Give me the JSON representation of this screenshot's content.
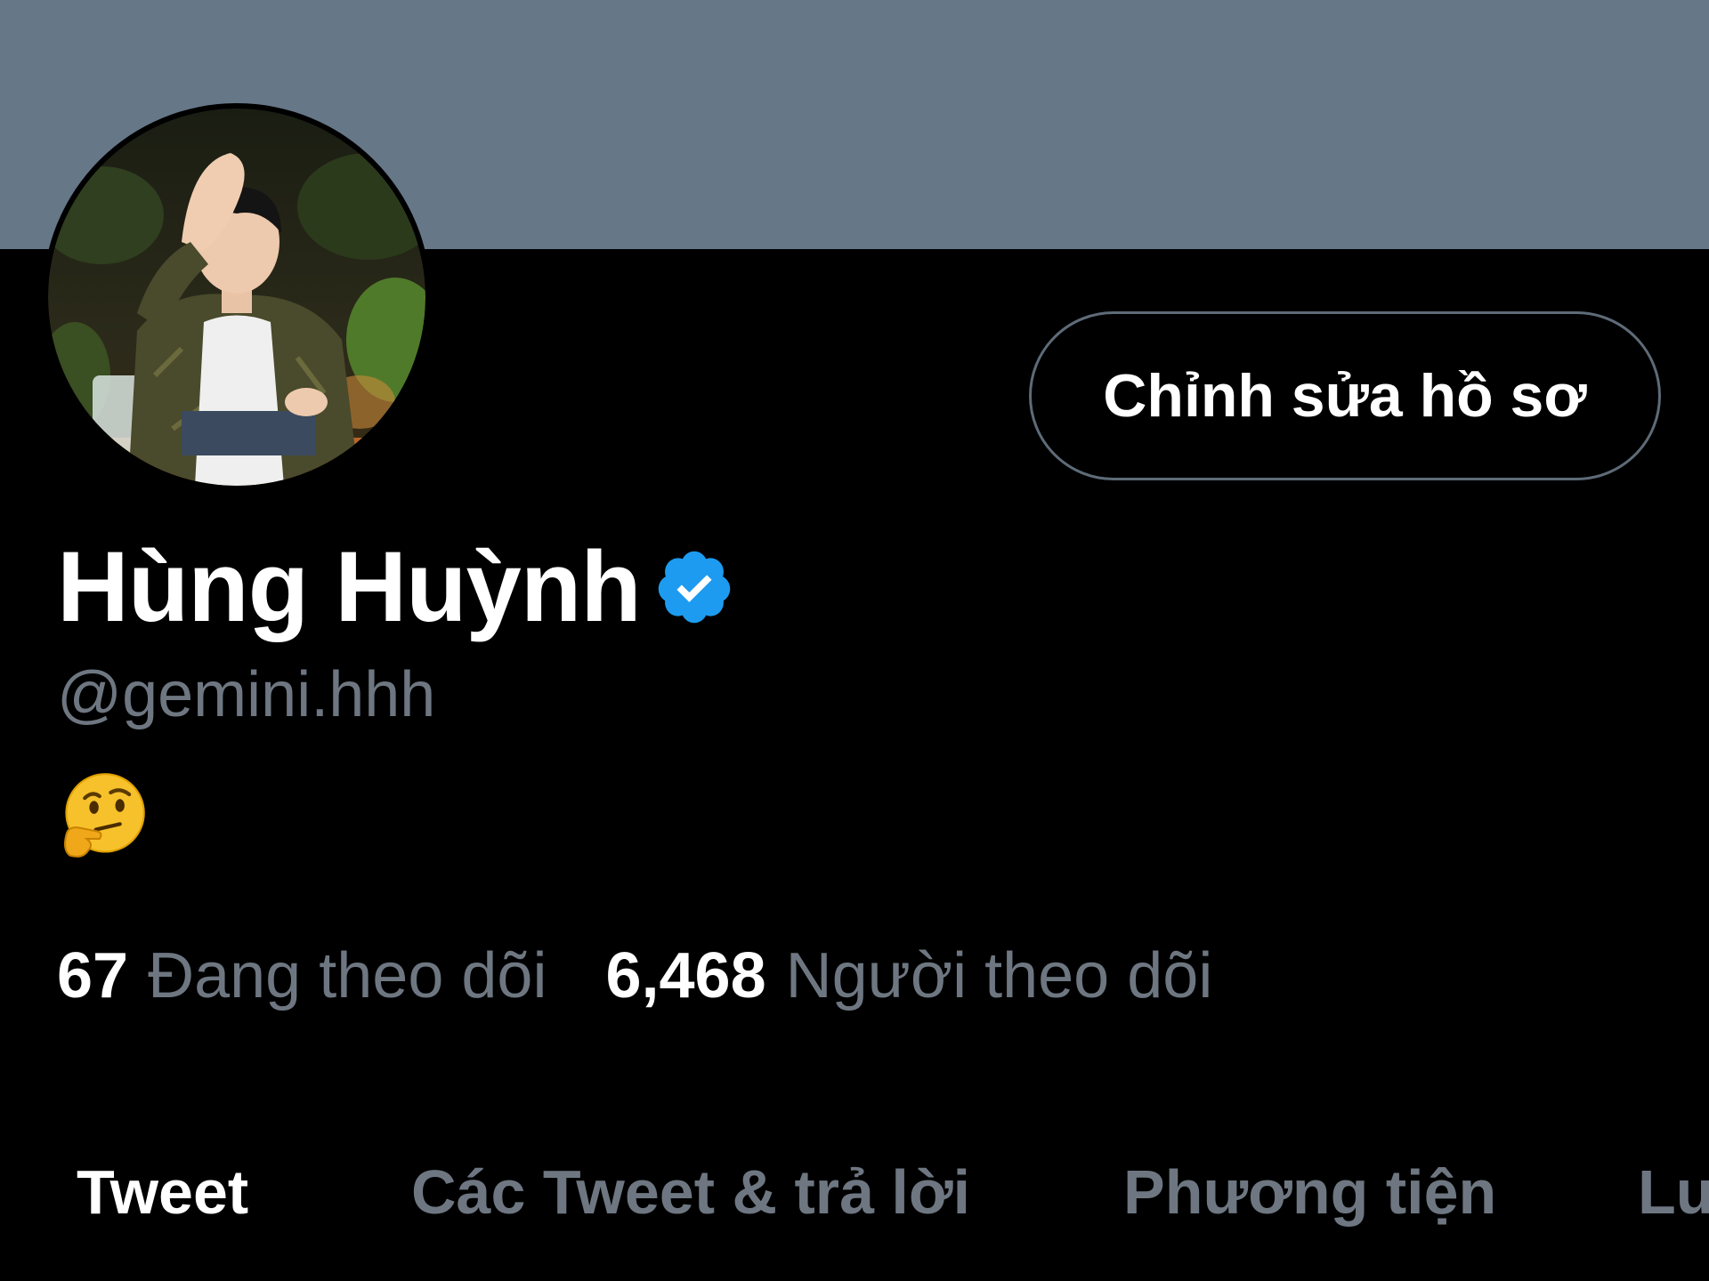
{
  "profile": {
    "display_name": "Hùng Huỳnh",
    "handle": "@gemini.hhh",
    "verified": true,
    "bio_emoji": "thinking-face",
    "edit_button_label": "Chỉnh sửa hồ sơ"
  },
  "stats": {
    "following_count": "67",
    "following_label": "Đang theo dõi",
    "followers_count": "6,468",
    "followers_label": "Người theo dõi"
  },
  "tabs": [
    {
      "label": "Tweet",
      "active": true
    },
    {
      "label": "Các Tweet & trả lời",
      "active": false
    },
    {
      "label": "Phương tiện",
      "active": false
    },
    {
      "label": "Lu",
      "active": false
    }
  ],
  "colors": {
    "banner": "#667788",
    "background": "#000000",
    "muted_text": "#6e7781",
    "verified_blue": "#1d9bf0",
    "button_border": "#5e6b78"
  }
}
